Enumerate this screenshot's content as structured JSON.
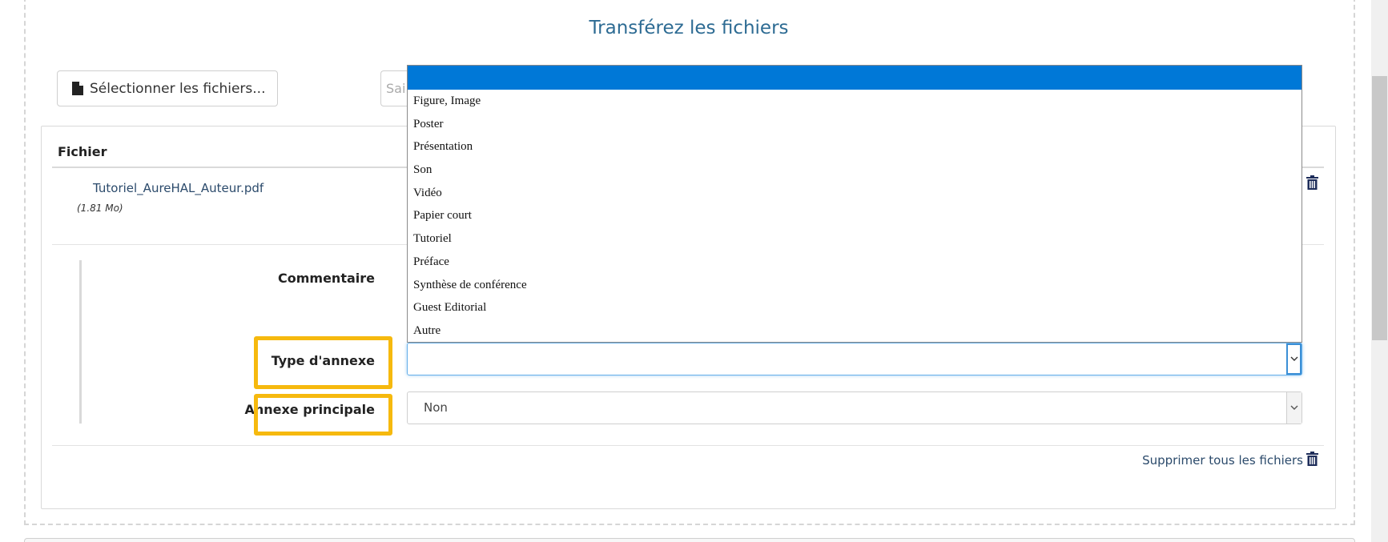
{
  "page": {
    "title": "Transférez les fichiers"
  },
  "toolbar": {
    "select_files_label": "Sélectionner les fichiers...",
    "search_placeholder_visible": "Sai"
  },
  "files_table": {
    "column_header": "Fichier",
    "file": {
      "name": "Tutoriel_AureHAL_Auteur.pdf",
      "size": "(1.81 Mo)"
    }
  },
  "form": {
    "comment_label": "Commentaire",
    "annex_type_label": "Type d'annexe",
    "annex_type_value": "",
    "main_annex_label": "Annexe principale",
    "main_annex_value": "Non"
  },
  "dropdown": {
    "selected": "",
    "options": [
      "Figure, Image",
      "Poster",
      "Présentation",
      "Son",
      "Vidéo",
      "Papier court",
      "Tutoriel",
      "Préface",
      "Synthèse de conférence",
      "Guest Editorial",
      "Autre"
    ]
  },
  "footer": {
    "delete_all_label": "Supprimer tous les fichiers"
  },
  "colors": {
    "title": "#2d6b93",
    "highlight": "#f6b90e",
    "dropdown_selected": "#0078d7",
    "link": "#2b4a6b"
  },
  "icons": {
    "file": "file-icon",
    "trash": "trash-icon",
    "chevron": "chevron-down-icon"
  }
}
